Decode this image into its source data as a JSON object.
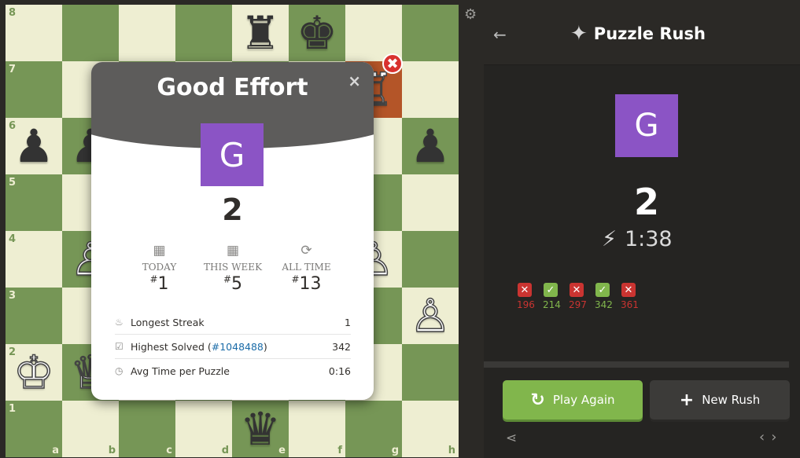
{
  "board": {
    "ranks": [
      "8",
      "7",
      "6",
      "5",
      "4",
      "3",
      "2",
      "1"
    ],
    "files": [
      "a",
      "b",
      "c",
      "d",
      "e",
      "f",
      "g",
      "h"
    ],
    "pieces": [
      {
        "square": "e8",
        "glyph": "♜",
        "color": "black",
        "name": "black-rook"
      },
      {
        "square": "f8",
        "glyph": "♚",
        "color": "black",
        "name": "black-king"
      },
      {
        "square": "g7",
        "glyph": "♖",
        "color": "white",
        "name": "white-rook"
      },
      {
        "square": "a6",
        "glyph": "♟",
        "color": "black",
        "name": "black-pawn"
      },
      {
        "square": "b6",
        "glyph": "♟",
        "color": "black",
        "name": "black-pawn"
      },
      {
        "square": "h6",
        "glyph": "♟",
        "color": "black",
        "name": "black-pawn"
      },
      {
        "square": "b4",
        "glyph": "♙",
        "color": "white",
        "name": "white-pawn"
      },
      {
        "square": "g4",
        "glyph": "♙",
        "color": "white",
        "name": "white-pawn"
      },
      {
        "square": "h3",
        "glyph": "♙",
        "color": "white",
        "name": "white-pawn"
      },
      {
        "square": "a2",
        "glyph": "♔",
        "color": "white",
        "name": "white-king"
      },
      {
        "square": "b2",
        "glyph": "♕",
        "color": "white",
        "name": "white-queen"
      },
      {
        "square": "e1",
        "glyph": "♛",
        "color": "black",
        "name": "black-queen"
      }
    ],
    "highlight": "g7",
    "wrong_mark": "✖"
  },
  "popup": {
    "title": "Good Effort",
    "close": "×",
    "avatar_letter": "G",
    "score": "2",
    "ranks": [
      {
        "icon": "calendar-icon",
        "glyph": "▦",
        "label": "TODAY",
        "prefix": "#",
        "value": "1"
      },
      {
        "icon": "calendar-icon",
        "glyph": "▦",
        "label": "THIS WEEK",
        "prefix": "#",
        "value": "5"
      },
      {
        "icon": "refresh-icon",
        "glyph": "⟳",
        "label": "ALL TIME",
        "prefix": "#",
        "value": "13"
      }
    ],
    "stats": [
      {
        "icon": "flame-icon",
        "glyph": "♨",
        "label": "Longest Streak",
        "link": "",
        "value": "1"
      },
      {
        "icon": "checkbox-icon",
        "glyph": "☑",
        "label": "Highest Solved (",
        "link": "#1048488",
        "tail": ")",
        "value": "342"
      },
      {
        "icon": "clock-icon",
        "glyph": "◷",
        "label": "Avg Time per Puzzle",
        "link": "",
        "value": "0:16"
      }
    ]
  },
  "panel": {
    "title": "Puzzle Rush",
    "back_glyph": "←",
    "title_icon_glyph": "✦",
    "avatar_letter": "G",
    "score": "2",
    "timer": "1:38",
    "timer_glyph": "⚡",
    "results": [
      {
        "status": "fail",
        "mark": "✕",
        "value": "196"
      },
      {
        "status": "pass",
        "mark": "✓",
        "value": "214"
      },
      {
        "status": "fail",
        "mark": "✕",
        "value": "297"
      },
      {
        "status": "pass",
        "mark": "✓",
        "value": "342"
      },
      {
        "status": "fail",
        "mark": "✕",
        "value": "361"
      }
    ],
    "play_again": "Play Again",
    "play_again_glyph": "↻",
    "new_rush": "New Rush",
    "new_rush_glyph": "+",
    "share_glyph": "⋖",
    "prev_glyph": "‹",
    "next_glyph": "›"
  },
  "settings_glyph": "⚙",
  "colors": {
    "light": "#eeeed2",
    "dark": "#769656",
    "accent_green": "#81b64c",
    "fail_red": "#ca3431",
    "avatar_purple": "#8b54c5"
  }
}
